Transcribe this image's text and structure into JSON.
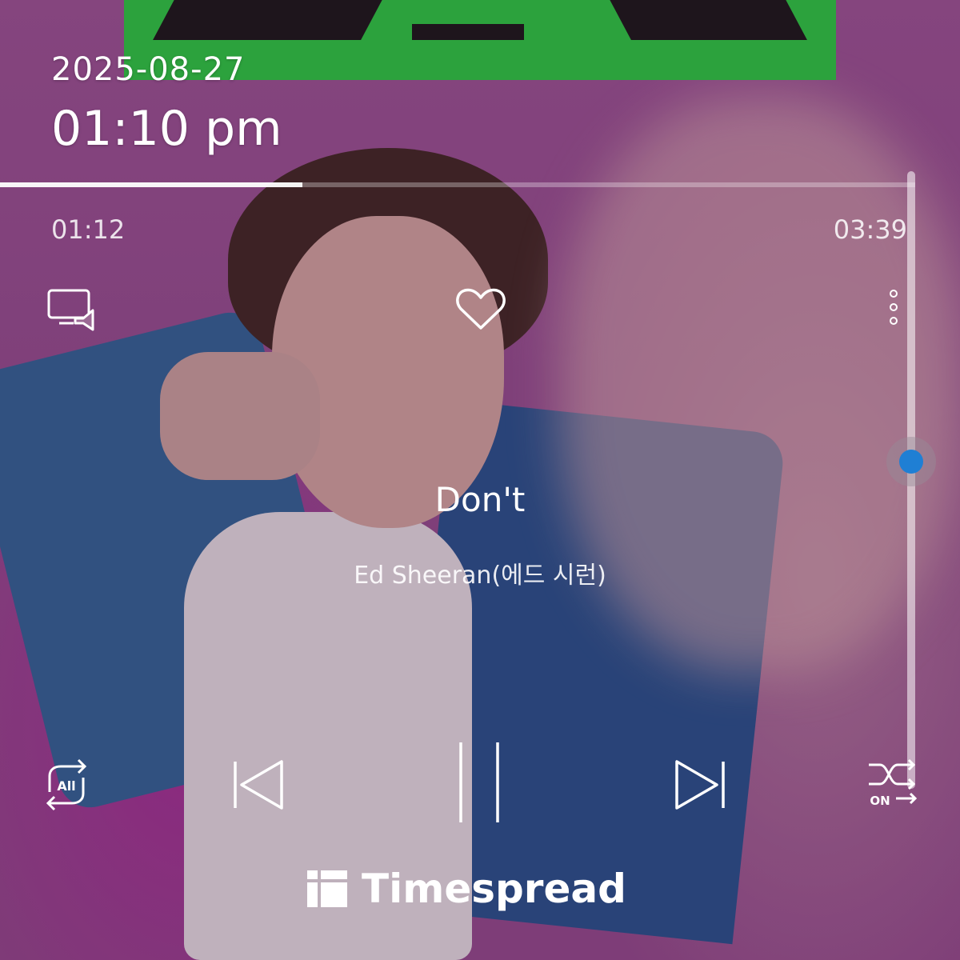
{
  "status": {
    "date": "2025-08-27",
    "time": "01:10 pm"
  },
  "player": {
    "elapsed": "01:12",
    "total": "03:39",
    "progress_fraction": 0.33,
    "volume_fraction": 0.53
  },
  "track": {
    "title": "Don't",
    "artist": "Ed Sheeran(에드 시런)"
  },
  "controls": {
    "repeat_label": "All",
    "shuffle_label": "ON",
    "icons": [
      "cast-icon",
      "heart-icon",
      "more-vertical-icon",
      "repeat-all-icon",
      "previous-icon",
      "pause-icon",
      "next-icon",
      "shuffle-icon"
    ]
  },
  "brand": {
    "name": "Timespread"
  },
  "colors": {
    "accent": "#1f7fd4",
    "album_green": "#27c13d"
  }
}
